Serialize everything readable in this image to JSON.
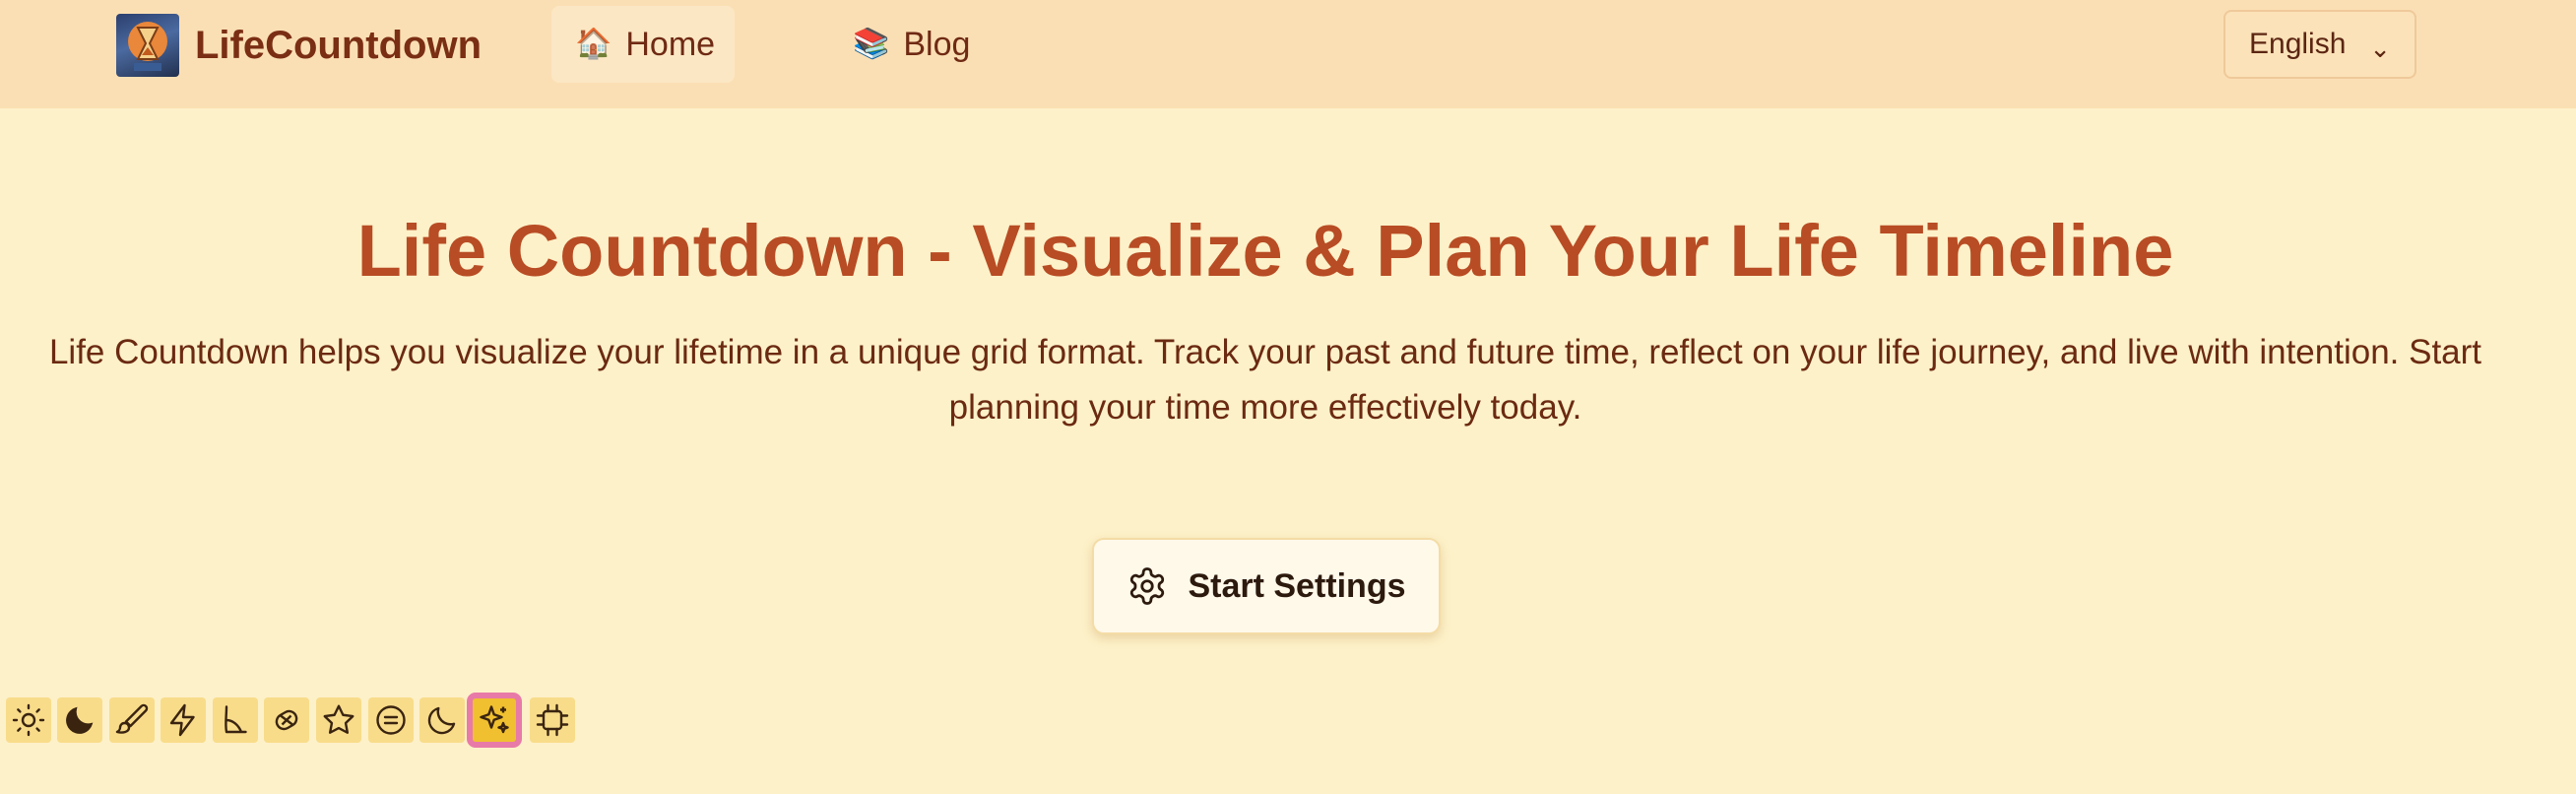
{
  "navbar": {
    "brand": "LifeCountdown",
    "links": [
      {
        "icon": "🏠",
        "label": "Home"
      },
      {
        "icon": "📚",
        "label": "Blog"
      }
    ],
    "language": {
      "selected": "English",
      "chevron": "⌄"
    }
  },
  "hero": {
    "title": "Life Countdown - Visualize & Plan Your Life Timeline",
    "description": "Life Countdown helps you visualize your lifetime in a unique grid format. Track your past and future time, reflect on your life journey, and live with intention. Start planning your time more effectively today."
  },
  "start_button": {
    "label": "Start Settings",
    "icon": "gear-icon"
  },
  "themes": {
    "icons": [
      "sun-icon",
      "moon-filled-icon",
      "brush-icon",
      "lightning-icon",
      "cat-icon",
      "candy-icon",
      "star-icon",
      "smile-icon",
      "crescent-icon",
      "sparkles-icon",
      "chip-icon"
    ],
    "active_index": 9,
    "colors": {
      "button_bg": "#f8dc8a",
      "active_bg": "#f0c030",
      "active_outline": "#e87aa8"
    }
  },
  "colors": {
    "page_bg": "#fdf1c9",
    "nav_bg": "#fbdfb4",
    "title": "#b84c24",
    "text": "#6b2a12"
  }
}
